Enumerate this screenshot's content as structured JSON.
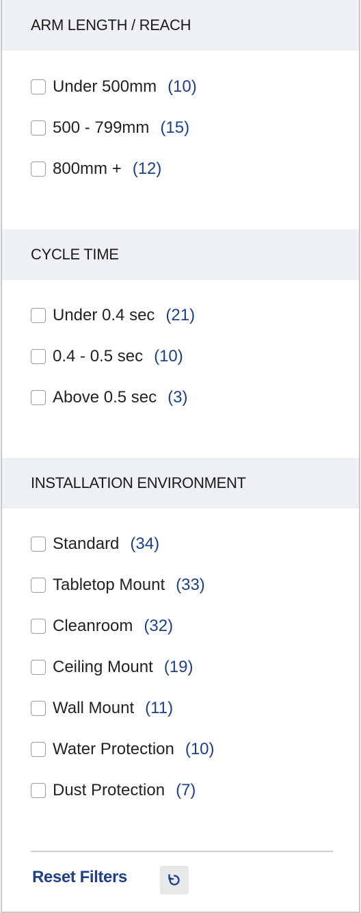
{
  "sections": [
    {
      "title": "ARM LENGTH / REACH",
      "options": [
        {
          "label": "Under 500mm",
          "count": "(10)"
        },
        {
          "label": "500 - 799mm",
          "count": "(15)"
        },
        {
          "label": "800mm +",
          "count": "(12)"
        }
      ]
    },
    {
      "title": "CYCLE TIME",
      "options": [
        {
          "label": "Under 0.4 sec",
          "count": "(21)"
        },
        {
          "label": "0.4 - 0.5 sec",
          "count": "(10)"
        },
        {
          "label": "Above 0.5 sec",
          "count": "(3)"
        }
      ]
    },
    {
      "title": "INSTALLATION ENVIRONMENT",
      "options": [
        {
          "label": "Standard",
          "count": "(34)"
        },
        {
          "label": "Tabletop Mount",
          "count": "(33)"
        },
        {
          "label": "Cleanroom",
          "count": "(32)"
        },
        {
          "label": "Ceiling Mount",
          "count": "(19)"
        },
        {
          "label": "Wall Mount",
          "count": "(11)"
        },
        {
          "label": "Water Protection",
          "count": "(10)"
        },
        {
          "label": "Dust Protection",
          "count": "(7)"
        }
      ]
    }
  ],
  "footer": {
    "reset_label": "Reset Filters",
    "reset_icon": "refresh-icon"
  },
  "colors": {
    "accent": "#1d3f8a",
    "header_bg": "#eef1f3"
  }
}
